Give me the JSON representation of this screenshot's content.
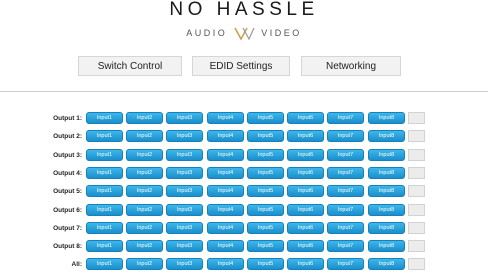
{
  "brand": {
    "title": "NO HASSLE",
    "sub_left": "AUDIO",
    "sub_right": "VIDEO",
    "logo_mark_icon": "av-chevron-icon",
    "accent": "#c9a24a"
  },
  "nav": {
    "switch_control": "Switch Control",
    "edid_settings": "EDID Settings",
    "networking": "Networking"
  },
  "matrix": {
    "button_color": "#27a3dc",
    "rows": [
      {
        "label": "Output 1:",
        "inputs": [
          "Input1",
          "Input2",
          "Input3",
          "Input4",
          "Input5",
          "Input6",
          "Input7",
          "Input8"
        ]
      },
      {
        "label": "Output 2:",
        "inputs": [
          "Input1",
          "Input2",
          "Input3",
          "Input4",
          "Input5",
          "Input6",
          "Input7",
          "Input8"
        ]
      },
      {
        "label": "Output 3:",
        "inputs": [
          "Input1",
          "Input2",
          "Input3",
          "Input4",
          "Input5",
          "Input6",
          "Input7",
          "Input8"
        ]
      },
      {
        "label": "Output 4:",
        "inputs": [
          "Input1",
          "Input2",
          "Input3",
          "Input4",
          "Input5",
          "Input6",
          "Input7",
          "Input8"
        ]
      },
      {
        "label": "Output 5:",
        "inputs": [
          "Input1",
          "Input2",
          "Input3",
          "Input4",
          "Input5",
          "Input6",
          "Input7",
          "Input8"
        ]
      },
      {
        "label": "Output 6:",
        "inputs": [
          "Input1",
          "Input2",
          "Input3",
          "Input4",
          "Input5",
          "Input6",
          "Input7",
          "Input8"
        ]
      },
      {
        "label": "Output 7:",
        "inputs": [
          "Input1",
          "Input2",
          "Input3",
          "Input4",
          "Input5",
          "Input6",
          "Input7",
          "Input8"
        ]
      },
      {
        "label": "Output 8:",
        "inputs": [
          "Input1",
          "Input2",
          "Input3",
          "Input4",
          "Input5",
          "Input6",
          "Input7",
          "Input8"
        ]
      },
      {
        "label": "All:",
        "inputs": [
          "Input1",
          "Input2",
          "Input3",
          "Input4",
          "Input5",
          "Input6",
          "Input7",
          "Input8"
        ]
      }
    ]
  }
}
